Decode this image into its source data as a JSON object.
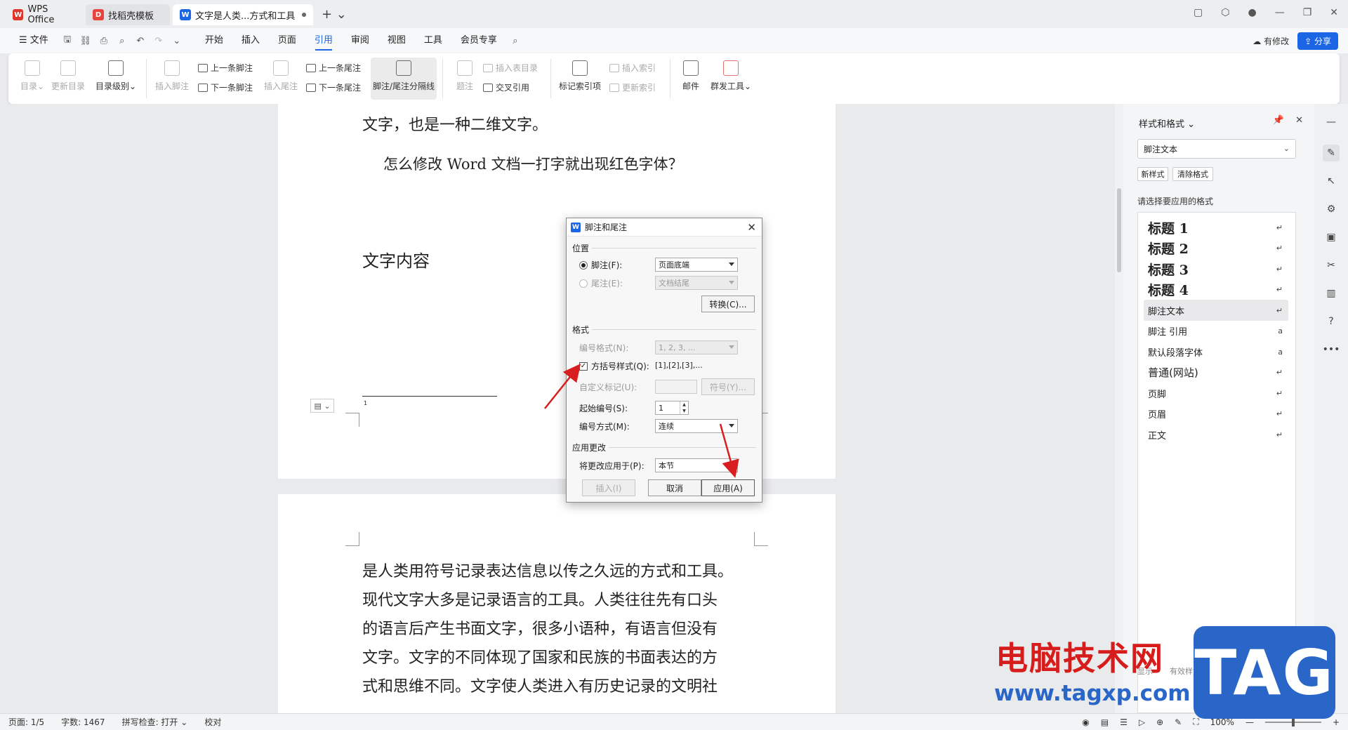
{
  "tabs": [
    {
      "label": "WPS Office"
    },
    {
      "label": "找稻壳模板"
    },
    {
      "label": "文字是人类...方式和工具"
    }
  ],
  "menu": {
    "file": "文件",
    "items": [
      "开始",
      "插入",
      "页面",
      "引用",
      "审阅",
      "视图",
      "工具",
      "会员专享"
    ],
    "active": "引用",
    "has_changes": "有修改",
    "share": "分享"
  },
  "ribbon": {
    "toc": "目录",
    "update_toc": "更新目录",
    "toc_level": "目录级别",
    "insert_footnote": "插入脚注",
    "prev_footnote": "上一条脚注",
    "next_footnote": "下一条脚注",
    "insert_endnote": "插入尾注",
    "prev_endnote": "上一条尾注",
    "next_endnote": "下一条尾注",
    "separator_line": "脚注/尾注分隔线",
    "caption": "题注",
    "insert_table_of_figures": "插入表目录",
    "cross_reference": "交叉引用",
    "mark_index": "标记索引项",
    "insert_index": "插入索引",
    "update_index": "更新索引",
    "mail": "邮件",
    "mass_mail": "群发工具"
  },
  "document": {
    "page1_lines": [
      "文字，也是一种二维文字。",
      "怎么修改 Word 文档一打字就出现红色字体？",
      "文字内容"
    ],
    "footnote_mark": "1",
    "page2_lines": [
      "是人类用符号记录表达信息以传之久远的方式和工具。",
      "现代文字大多是记录语言的工具。人类往往先有口头",
      "的语言后产生书面文字，很多小语种，有语言但没有",
      "文字。文字的不同体现了国家和民族的书面表达的方",
      "式和思维不同。文字使人类进入有历史记录的文明社"
    ]
  },
  "dialog": {
    "title": "脚注和尾注",
    "section_position": "位置",
    "footnote_label": "脚注(F):",
    "footnote_value": "页面底端",
    "endnote_label": "尾注(E):",
    "endnote_value": "文档结尾",
    "convert": "转换(C)...",
    "section_format": "格式",
    "number_format_label": "编号格式(N):",
    "number_format_value": "1, 2, 3, ...",
    "bracket_label": "方括号样式(Q):",
    "bracket_preview": "[1],[2],[3],...",
    "custom_mark_label": "自定义标记(U):",
    "symbol": "符号(Y)...",
    "start_label": "起始编号(S):",
    "start_value": "1",
    "numbering_label": "编号方式(M):",
    "numbering_value": "连续",
    "section_apply": "应用更改",
    "apply_to_label": "将更改应用于(P):",
    "apply_to_value": "本节",
    "insert": "插入(I)",
    "cancel": "取消",
    "apply": "应用(A)"
  },
  "style_pane": {
    "title": "样式和格式",
    "current_style": "脚注文本",
    "new_style": "新样式",
    "clear_format": "清除格式",
    "hint": "请选择要应用的格式",
    "styles": [
      {
        "label": "标题  1",
        "kind": "heading"
      },
      {
        "label": "标题  2",
        "kind": "heading"
      },
      {
        "label": "标题  3",
        "kind": "heading"
      },
      {
        "label": "标题 4",
        "kind": "heading"
      },
      {
        "label": "脚注文本",
        "kind": "small",
        "selected": true
      },
      {
        "label": "脚注 引用",
        "kind": "small"
      },
      {
        "label": "默认段落字体",
        "kind": "small"
      },
      {
        "label": "普通(网站)",
        "kind": "mid"
      },
      {
        "label": "页脚",
        "kind": "small"
      },
      {
        "label": "页眉",
        "kind": "small"
      },
      {
        "label": "正文",
        "kind": "small"
      }
    ],
    "show": "显示",
    "valid_styles": "有效样式"
  },
  "status": {
    "page": "页面: 1/5",
    "words": "字数: 1467",
    "spell": "拼写检查: 打开",
    "proof": "校对",
    "zoom": "100%"
  },
  "watermark": {
    "site_cn": "电脑技术网",
    "site_url": "www.tagxp.com",
    "tag": "TAG"
  },
  "colors": {
    "accent": "#1c66e6",
    "arrow": "#d81e1e"
  }
}
